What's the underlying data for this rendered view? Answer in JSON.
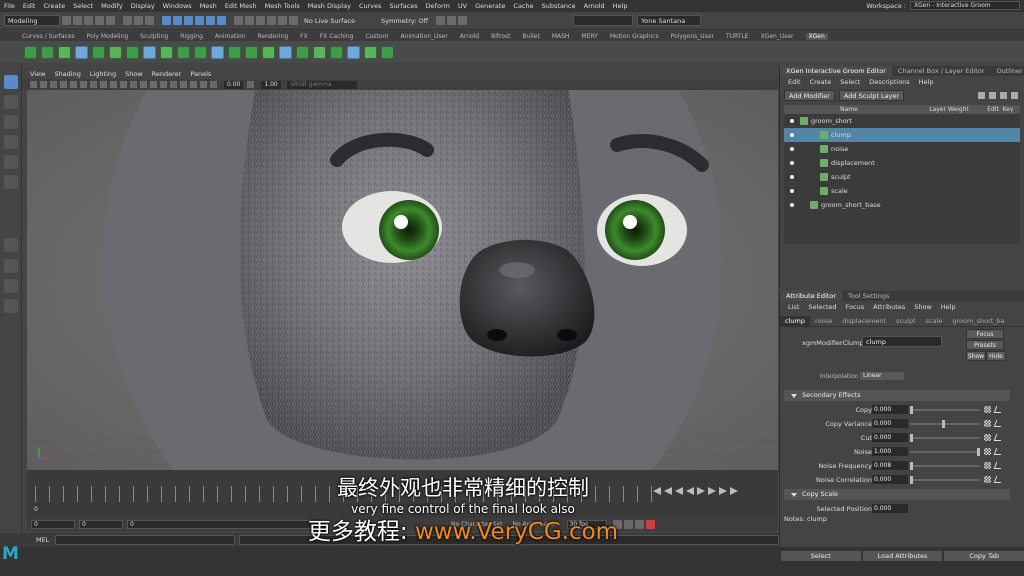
{
  "menubar": {
    "items": [
      "File",
      "Edit",
      "Create",
      "Select",
      "Modify",
      "Display",
      "Windows",
      "Mesh",
      "Edit Mesh",
      "Mesh Tools",
      "Mesh Display",
      "Curves",
      "Surfaces",
      "Deform",
      "UV",
      "Generate",
      "Cache",
      "Substance",
      "Arnold",
      "Help"
    ],
    "workspace_label": "Workspace :",
    "workspace_value": "XGen - Interactive Groom"
  },
  "statusline": {
    "mode": "Modeling",
    "live_surface": "No Live Surface",
    "symmetry": "Symmetry: Off",
    "user": "Yone Santana"
  },
  "shelf": {
    "tabs": [
      "Curves / Surfaces",
      "Poly Modeling",
      "Sculpting",
      "Rigging",
      "Animation",
      "Rendering",
      "FX",
      "FX Caching",
      "Custom",
      "Animation_User",
      "Arnold",
      "Bifrost",
      "Bullet",
      "MASH",
      "MERY",
      "Motion Graphics",
      "Polygons_User",
      "TURTLE",
      "XGen_User",
      "XGen"
    ],
    "active_tab": "XGen"
  },
  "viewport": {
    "menus": [
      "View",
      "Shading",
      "Lighting",
      "Show",
      "Renderer",
      "Panels"
    ],
    "field_a": "0.00",
    "field_b": "1.00",
    "colorspace": "sRGB gamma"
  },
  "timeline": {
    "start": "0",
    "range_start": "0",
    "range_inner_start": "0",
    "range_inner_label": "0",
    "no_char_set": "No Character Set",
    "no_anim_layer": "No Anim Layer",
    "fps": "30 fps"
  },
  "cmdline": {
    "label": "MEL"
  },
  "xgen_panel": {
    "tabs": [
      "XGen Interactive Groom Editor",
      "Channel Box / Layer Editor",
      "Outliner"
    ],
    "menus": [
      "Edit",
      "Create",
      "Select",
      "Descriptions",
      "Help"
    ],
    "add_modifier": "Add Modifier",
    "add_sculpt_layer": "Add Sculpt Layer",
    "headers": {
      "name": "Name",
      "weight": "Layer Weight",
      "edit": "Edit",
      "key": "Key"
    },
    "layers": [
      {
        "name": "groom_short",
        "indent": 0
      },
      {
        "name": "clump",
        "indent": 2,
        "selected": true
      },
      {
        "name": "noise",
        "indent": 2
      },
      {
        "name": "displacement",
        "indent": 2
      },
      {
        "name": "sculpt",
        "indent": 2
      },
      {
        "name": "scale",
        "indent": 2
      },
      {
        "name": "groom_short_base",
        "indent": 1
      }
    ]
  },
  "attr_editor": {
    "tabs": [
      "Attribute Editor",
      "Tool Settings"
    ],
    "menus": [
      "List",
      "Selected",
      "Focus",
      "Attributes",
      "Show",
      "Help"
    ],
    "node_tabs": [
      "clump",
      "noise",
      "displacement",
      "sculpt",
      "scale",
      "groom_short_ba"
    ],
    "node_label": "xgmModifierClump:",
    "node_value": "clump",
    "focus": "Focus",
    "presets": "Presets",
    "show": "Show",
    "hide": "Hide",
    "interpolation_label": "Interpolation",
    "interpolation_value": "Linear",
    "section_secondary": "Secondary Effects",
    "attrs": [
      {
        "label": "Copy",
        "value": "0.000",
        "level": 0.0
      },
      {
        "label": "Copy Variance",
        "value": "0.000",
        "level": 0.48
      },
      {
        "label": "Cut",
        "value": "0.000",
        "level": 0.0
      },
      {
        "label": "Noise",
        "value": "1.000",
        "level": 1.0
      },
      {
        "label": "Noise Frequency",
        "value": "0.008",
        "level": 0.0
      },
      {
        "label": "Noise Correlation",
        "value": "0.000",
        "level": 0.0
      }
    ],
    "section_copy_scale": "Copy Scale",
    "selected_position_label": "Selected Position",
    "selected_position_value": "0.000",
    "notes_label": "Notes:  clump",
    "buttons": [
      "Select",
      "Load Attributes",
      "Copy Tab"
    ]
  },
  "subtitles": {
    "line1": "最终外观也非常精细的控制",
    "line2": "very fine control of the final look also",
    "line3_prefix": "更多教程: ",
    "line3_url": "www.VeryCG.com"
  },
  "colors": {
    "accent": "#5285a6",
    "maya_logo": "#29a9c8",
    "subtitle_url": "#f08a1c",
    "fur": "#7e7e84",
    "eye_iris": "#3d8a2c"
  }
}
